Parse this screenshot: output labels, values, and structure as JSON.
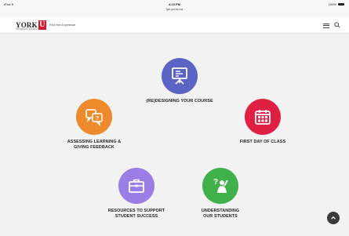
{
  "status_bar": {
    "device": "iPad",
    "wifi": "≋",
    "time": "4:10 PM",
    "url": "fye.yorku.ca",
    "battery": "100%"
  },
  "header": {
    "logo_text": "YORK",
    "logo_letter": "U",
    "logo_sub": "UNIVERSITÉ UNIVERSITY",
    "site_title": "First Year Experience"
  },
  "tiles": [
    {
      "label": "(RE)DESIGNING YOUR COURSE",
      "color": "#5b64c4",
      "icon": "presentation-board-icon"
    },
    {
      "label": "ASSESSING LEARNING &\nGIVING FEEDBACK",
      "color": "#ef8a2c",
      "icon": "speech-bubbles-icon"
    },
    {
      "label": "FIRST DAY OF CLASS",
      "color": "#df1f43",
      "icon": "calendar-icon"
    },
    {
      "label": "RESOURCES TO SUPPORT\nSTUDENT SUCCESS",
      "color": "#9a7ee6",
      "icon": "briefcase-icon"
    },
    {
      "label": "UNDERSTANDING\nOUR STUDENTS",
      "color": "#3fb04a",
      "icon": "student-question-icon"
    }
  ],
  "back_to_top_icon": "chevron-up-icon"
}
